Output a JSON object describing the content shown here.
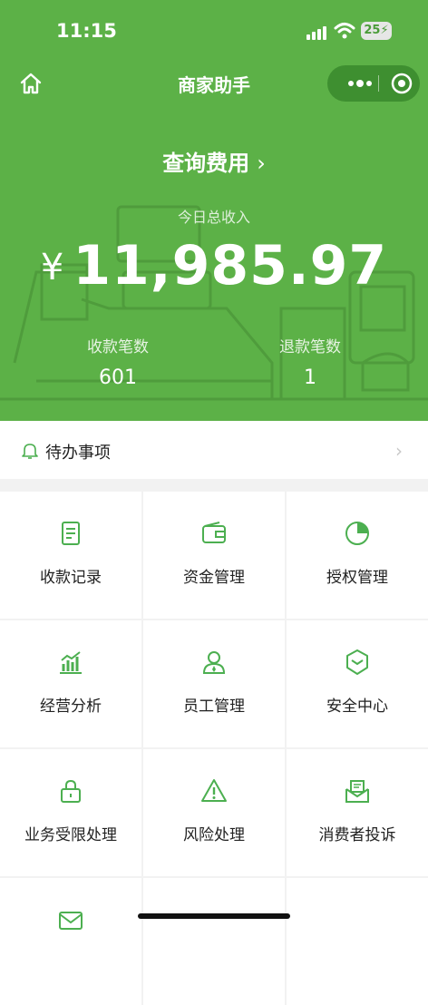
{
  "status_bar": {
    "time": "11:15",
    "battery": "25"
  },
  "nav": {
    "title": "商家助手",
    "home_icon": "home-icon",
    "more_icon": "more-dots-icon",
    "close_icon": "target-icon"
  },
  "summary": {
    "query_label": "查询费用",
    "query_chevron": "›",
    "today_label": "今日总收入",
    "currency": "¥",
    "amount": "11,985.97",
    "receipts_label": "收款笔数",
    "receipts_value": "601",
    "refunds_label": "退款笔数",
    "refunds_value": "1"
  },
  "todo": {
    "label": "待办事项",
    "arrow": "›"
  },
  "menu": [
    {
      "label": "收款记录",
      "icon": "receipt-icon"
    },
    {
      "label": "资金管理",
      "icon": "wallet-icon"
    },
    {
      "label": "授权管理",
      "icon": "pie-chart-icon"
    },
    {
      "label": "经营分析",
      "icon": "bar-chart-icon"
    },
    {
      "label": "员工管理",
      "icon": "person-icon"
    },
    {
      "label": "安全中心",
      "icon": "shield-icon"
    },
    {
      "label": "业务受限处理",
      "icon": "lock-icon"
    },
    {
      "label": "风险处理",
      "icon": "warning-icon"
    },
    {
      "label": "消费者投诉",
      "icon": "complaint-mail-icon"
    },
    {
      "label": "",
      "icon": "envelope-icon"
    }
  ],
  "colors": {
    "brand_green": "#5cb147",
    "icon_green": "#4caf50"
  }
}
